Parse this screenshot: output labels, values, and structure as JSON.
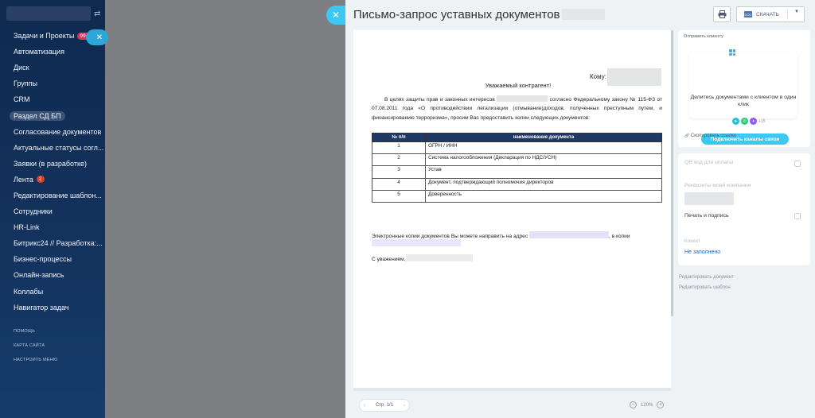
{
  "sidebar": {
    "toggle_icon": "⇄",
    "items": [
      {
        "label": "Задачи и Проекты",
        "badge": "99+",
        "badge_color": "#e0315a"
      },
      {
        "label": "Автоматизация"
      },
      {
        "label": "Диск"
      },
      {
        "label": "Группы"
      },
      {
        "label": "CRM"
      },
      {
        "label": "Раздел СД БП",
        "active": true
      },
      {
        "label": "Согласование документов"
      },
      {
        "label": "Актуальные статусы согл..."
      },
      {
        "label": "Заявки (в разработке)"
      },
      {
        "label": "Лента",
        "badge": "2",
        "badge_color": "#d9402b"
      },
      {
        "label": "Редактирование шаблон..."
      },
      {
        "label": "Сотрудники"
      },
      {
        "label": "HR-Link"
      },
      {
        "label": "Битрикс24 // Разработка:..."
      },
      {
        "label": "Бизнес-процессы"
      },
      {
        "label": "Онлайн-запись"
      },
      {
        "label": "Коллабы"
      },
      {
        "label": "Навигатор задач"
      }
    ],
    "footer": [
      "ПОМОЩЬ",
      "КАРТА САЙТА",
      "НАСТРОИТЬ МЕНЮ"
    ]
  },
  "slider": {
    "close_icon": "✕",
    "title": "Письмо-запрос уставных документов",
    "print_icon": "printer-icon",
    "download_label": "СКАЧАТЬ",
    "download_doc_icon": "DOC",
    "download_caret": "▼"
  },
  "document": {
    "to_label": "Кому:",
    "greeting": "Уважаемый контрагент!",
    "para_part1": "В целях защиты прав и законных интересов",
    "para_part2": "согласно Федеральному закону № 115-ФЗ от 07.08.2011 года «О противодействии легализации (отмывание)доходов, полученных преступным путем, и финансированию терроризма», просим Вас предоставить копии следующих документов:",
    "table": {
      "headers": [
        "№ п/п",
        "наименование документа"
      ],
      "rows": [
        [
          "1",
          "ОГРН / ИНН"
        ],
        [
          "2",
          "Система налогообложения (Декларация по НДС/УСН)"
        ],
        [
          "3",
          "Устав"
        ],
        [
          "4",
          "Документ, подтверждающий полномочия директоров"
        ],
        [
          "5",
          "Доверенность"
        ]
      ]
    },
    "email_text": "Электронные копии документов Вы можете направить на адрес",
    "email_suffix": ",  в копии",
    "signoff": "С уважением,"
  },
  "pager": {
    "prev": "‹",
    "label": "Стр. 1/1",
    "next": "›"
  },
  "zoom": {
    "minus": "−",
    "value": "120%",
    "plus": "+"
  },
  "share": {
    "header": "Отправить клиенту",
    "text": "Делитесь документами с клиентом в один клик",
    "more_count": "+15",
    "connect_label": "Подключить каналы связи",
    "copy_link": "Скопировать ссылку",
    "copy_icon": "🔗",
    "accent": "#3bc8f5"
  },
  "options": {
    "qr_label": "QR код для оплаты",
    "requisites_label": "Реквизиты моей компании",
    "print_sign_label": "Печать и подпись",
    "client_label": "Клиент",
    "client_value": "Не заполнено"
  },
  "links": {
    "edit_document": "Редактировать документ",
    "edit_template": "Редактировать шаблон"
  }
}
